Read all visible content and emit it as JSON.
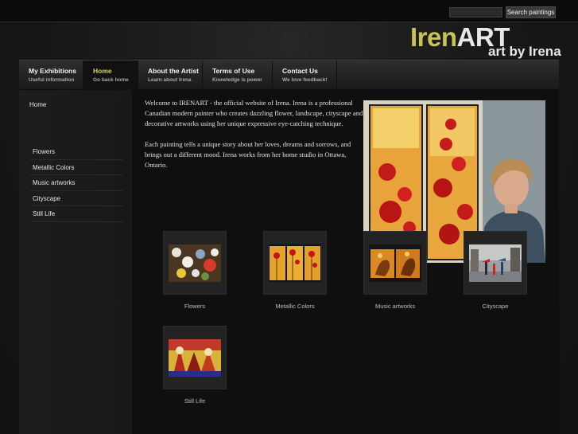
{
  "search": {
    "placeholder": "",
    "button_label": "Search paintings"
  },
  "logo": {
    "part1": "Iren",
    "part2": "ART",
    "tagline": "art by Irena"
  },
  "nav": [
    {
      "title": "My Exhibitions",
      "subtitle": "Useful information"
    },
    {
      "title": "Home",
      "subtitle": "Go back home"
    },
    {
      "title": "About the Artist",
      "subtitle": "Learn about Irena"
    },
    {
      "title": "Terms of Use",
      "subtitle": "Knowledge is power"
    },
    {
      "title": "Contact Us",
      "subtitle": "We love feedback!"
    }
  ],
  "sidebar": {
    "home": "Home",
    "items": [
      "Flowers",
      "Metallic Colors",
      "Music artworks",
      "Cityscape",
      "Still Life"
    ]
  },
  "intro": {
    "paragraph1": "Welcome to IRENART - the official website of Irena. Irena is a professional Canadian modern painter who creates dazzling flower, landscape, cityscape and decorative artworks using her unique expressive eye-catching technique.",
    "paragraph2": "Each painting tells a unique story about her loves, dreams and sorrows, and brings out a different mood. Irena works from her home studio in Ottawa, Ontario."
  },
  "gallery": [
    {
      "label": "Flowers"
    },
    {
      "label": "Metallic Colors"
    },
    {
      "label": "Music artworks"
    },
    {
      "label": "Cityscape"
    },
    {
      "label": "Still Life"
    }
  ],
  "colors": {
    "accent": "#d9cf5a",
    "logo_yellow": "#c9c256",
    "background": "#151515"
  }
}
